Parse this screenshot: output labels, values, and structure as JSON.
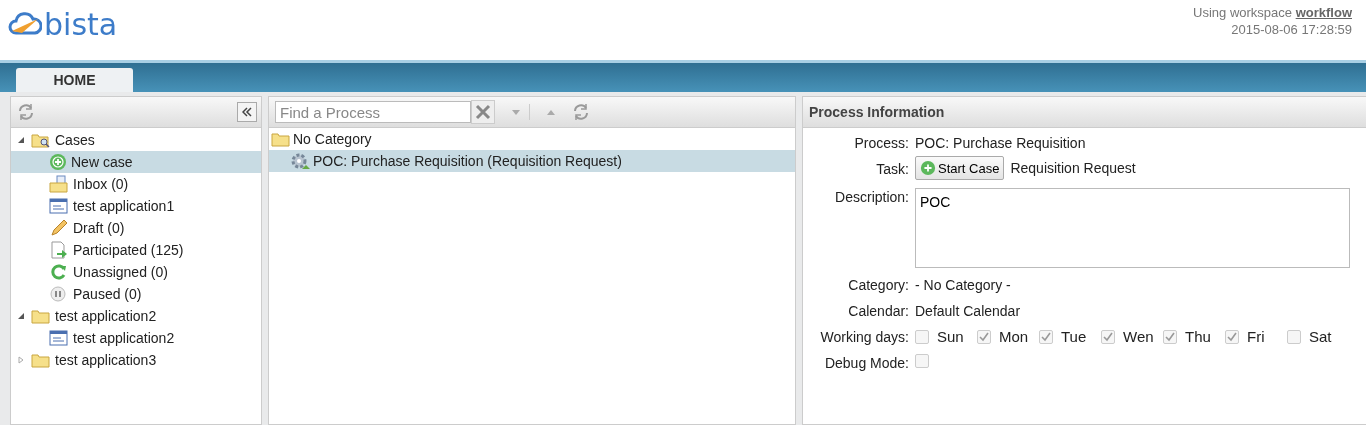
{
  "header": {
    "logo": "bista",
    "workspace_label": "Using workspace",
    "workspace": "workflow",
    "datetime": "2015-08-06 17:28:59"
  },
  "tabs": [
    {
      "label": "HOME",
      "selected": true
    }
  ],
  "sidebar": {
    "tree": [
      {
        "label": "Cases",
        "kind": "search-folder",
        "expanded": true,
        "selected": false,
        "children": [
          {
            "label": "New case",
            "kind": "add",
            "selected": true
          },
          {
            "label": "Inbox (0)",
            "kind": "inbox",
            "selected": false
          },
          {
            "label": "test application1",
            "kind": "form",
            "selected": false
          },
          {
            "label": "Draft (0)",
            "kind": "pencil",
            "selected": false
          },
          {
            "label": "Participated (125)",
            "kind": "doc-arrow",
            "selected": false
          },
          {
            "label": "Unassigned (0)",
            "kind": "cycle",
            "selected": false
          },
          {
            "label": "Paused (0)",
            "kind": "pause",
            "selected": false
          }
        ]
      },
      {
        "label": "test application2",
        "kind": "folder",
        "expanded": true,
        "selected": false,
        "children": [
          {
            "label": "test application2",
            "kind": "form",
            "selected": false
          }
        ]
      },
      {
        "label": "test application3",
        "kind": "folder",
        "expanded": false,
        "selected": false
      }
    ]
  },
  "process_list": {
    "search": {
      "placeholder": "Find a Process"
    },
    "categories": [
      {
        "label": "No Category",
        "processes": [
          {
            "label": "POC: Purchase Requisition (Requisition Request)",
            "selected": true
          }
        ]
      }
    ]
  },
  "process_info": {
    "title": "Process Information",
    "process_label": "Process:",
    "process": "POC: Purchase Requisition",
    "task_label": "Task:",
    "start_button": "Start Case",
    "task": "Requisition Request",
    "description_label": "Description:",
    "description": "POC",
    "category_label": "Category:",
    "category": "- No Category -",
    "calendar_label": "Calendar:",
    "calendar": "Default Calendar",
    "working_days_label": "Working days:",
    "working_days": [
      {
        "label": "Sun",
        "checked": false
      },
      {
        "label": "Mon",
        "checked": true
      },
      {
        "label": "Tue",
        "checked": true
      },
      {
        "label": "Wen",
        "checked": true
      },
      {
        "label": "Thu",
        "checked": true
      },
      {
        "label": "Fri",
        "checked": true
      },
      {
        "label": "Sat",
        "checked": false
      }
    ],
    "debug_label": "Debug Mode:",
    "debug_mode": false
  }
}
